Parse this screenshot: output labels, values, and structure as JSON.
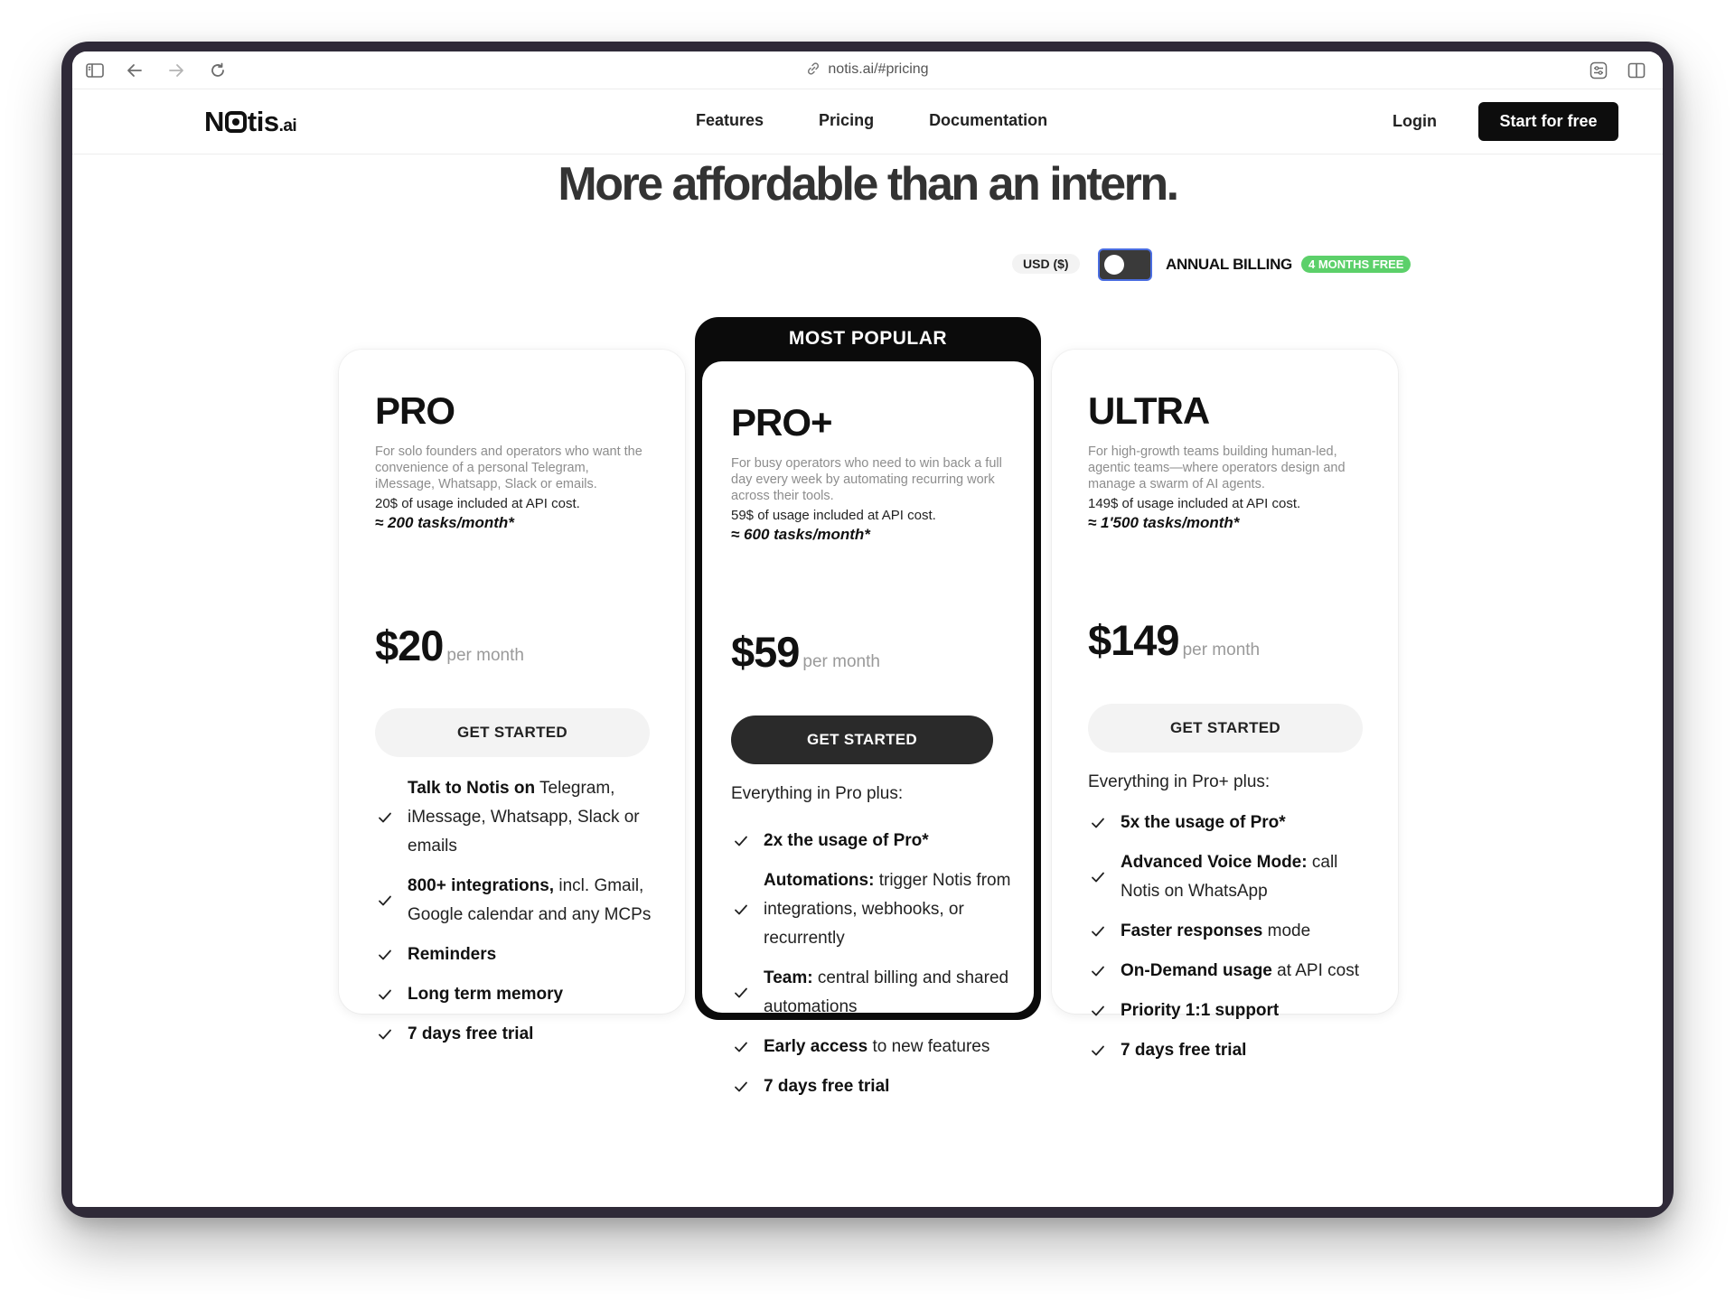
{
  "browser": {
    "url": "notis.ai/#pricing"
  },
  "nav": {
    "logo_prefix": "N",
    "logo_suffix": "tis",
    "logo_tld": ".ai",
    "links": [
      "Features",
      "Pricing",
      "Documentation"
    ],
    "login": "Login",
    "cta": "Start for free"
  },
  "hero": {
    "headline": "More affordable than an intern."
  },
  "billing": {
    "currency": "USD ($)",
    "annual_label": "ANNUAL BILLING",
    "annual_enabled": false,
    "promo_badge": "4 MONTHS FREE",
    "colors": {
      "badge": "#5cd06a",
      "toggle_outline": "#4a6de0"
    }
  },
  "plans": [
    {
      "name": "PRO",
      "description": "For solo founders and operators who want the convenience of a personal Telegram, iMessage, Whatsapp, Slack or emails.",
      "usage": "20$ of usage included at API cost.",
      "tasks": "≈ 200 tasks/month*",
      "price": "$20",
      "period": "per month",
      "button": "GET STARTED",
      "intro": "",
      "features": [
        {
          "bold": "Talk to Notis on",
          "text": " Telegram, iMessage, Whatsapp, Slack or emails"
        },
        {
          "bold": "800+ integrations,",
          "text": " incl. Gmail, Google calendar and any MCPs"
        },
        {
          "bold": "Reminders",
          "text": ""
        },
        {
          "bold": "Long term memory",
          "text": ""
        },
        {
          "bold": "7 days free trial",
          "text": ""
        }
      ]
    },
    {
      "badge": "MOST POPULAR",
      "name": "PRO+",
      "description": "For busy operators who need to win back a full day every week by automating recurring work across their tools.",
      "usage": "59$ of usage included at API cost.",
      "tasks": "≈ 600 tasks/month*",
      "price": "$59",
      "period": "per month",
      "button": "GET STARTED",
      "intro": "Everything in Pro plus:",
      "features": [
        {
          "bold": "2x the usage of Pro*",
          "text": ""
        },
        {
          "bold": "Automations:",
          "text": " trigger Notis from integrations, webhooks, or recurrently"
        },
        {
          "bold": "Team:",
          "text": " central billing and shared automations"
        },
        {
          "bold": "Early access",
          "text": " to new features"
        },
        {
          "bold": "7 days free trial",
          "text": ""
        }
      ]
    },
    {
      "name": "ULTRA",
      "description": "For high-growth teams building human-led, agentic teams—where operators design and manage a swarm of AI agents.",
      "usage": "149$ of usage included at API cost.",
      "tasks": "≈ 1'500 tasks/month*",
      "price": "$149",
      "period": "per month",
      "button": "GET STARTED",
      "intro": "Everything in Pro+ plus:",
      "features": [
        {
          "bold": "5x the usage of Pro*",
          "text": ""
        },
        {
          "bold": "Advanced Voice Mode:",
          "text": " call Notis on WhatsApp"
        },
        {
          "bold": "Faster responses",
          "text": " mode"
        },
        {
          "bold": "On-Demand usage",
          "text": " at API cost"
        },
        {
          "bold": "Priority 1:1 support",
          "text": ""
        },
        {
          "bold": "7 days free trial",
          "text": ""
        }
      ]
    }
  ]
}
